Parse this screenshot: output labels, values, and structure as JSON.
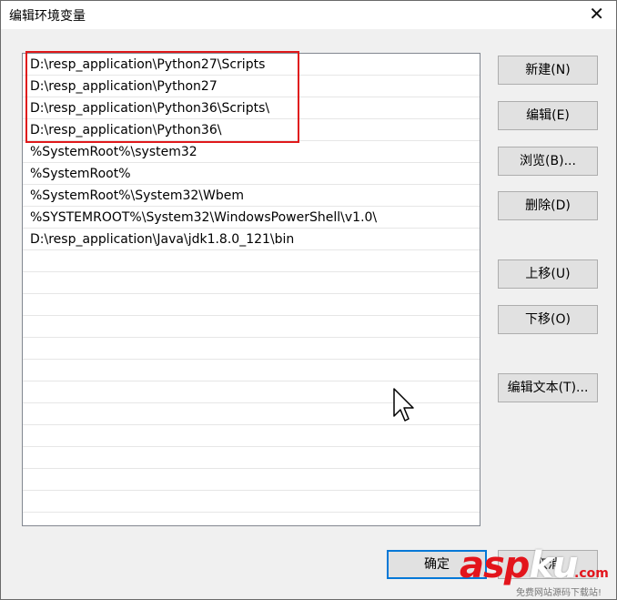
{
  "window": {
    "title": "编辑环境变量",
    "close_glyph": "✕"
  },
  "list": {
    "items": [
      "D:\\resp_application\\Python27\\Scripts",
      "D:\\resp_application\\Python27",
      "D:\\resp_application\\Python36\\Scripts\\",
      "D:\\resp_application\\Python36\\",
      "%SystemRoot%\\system32",
      "%SystemRoot%",
      "%SystemRoot%\\System32\\Wbem",
      "%SYSTEMROOT%\\System32\\WindowsPowerShell\\v1.0\\",
      "D:\\resp_application\\Java\\jdk1.8.0_121\\bin",
      "",
      "",
      "",
      "",
      "",
      "",
      "",
      "",
      "",
      "",
      "",
      "",
      ""
    ]
  },
  "buttons": {
    "new": "新建(N)",
    "edit": "编辑(E)",
    "browse": "浏览(B)...",
    "delete": "删除(D)",
    "move_up": "上移(U)",
    "move_down": "下移(O)",
    "edit_text": "编辑文本(T)...",
    "ok": "确定",
    "cancel": "取消"
  },
  "watermark": {
    "part1": "asp",
    "part2": "ku",
    "domain": ".com",
    "subtitle": "免费网站源码下载站!"
  },
  "colors": {
    "highlight": "#e0191b",
    "accent": "#0078d7"
  }
}
